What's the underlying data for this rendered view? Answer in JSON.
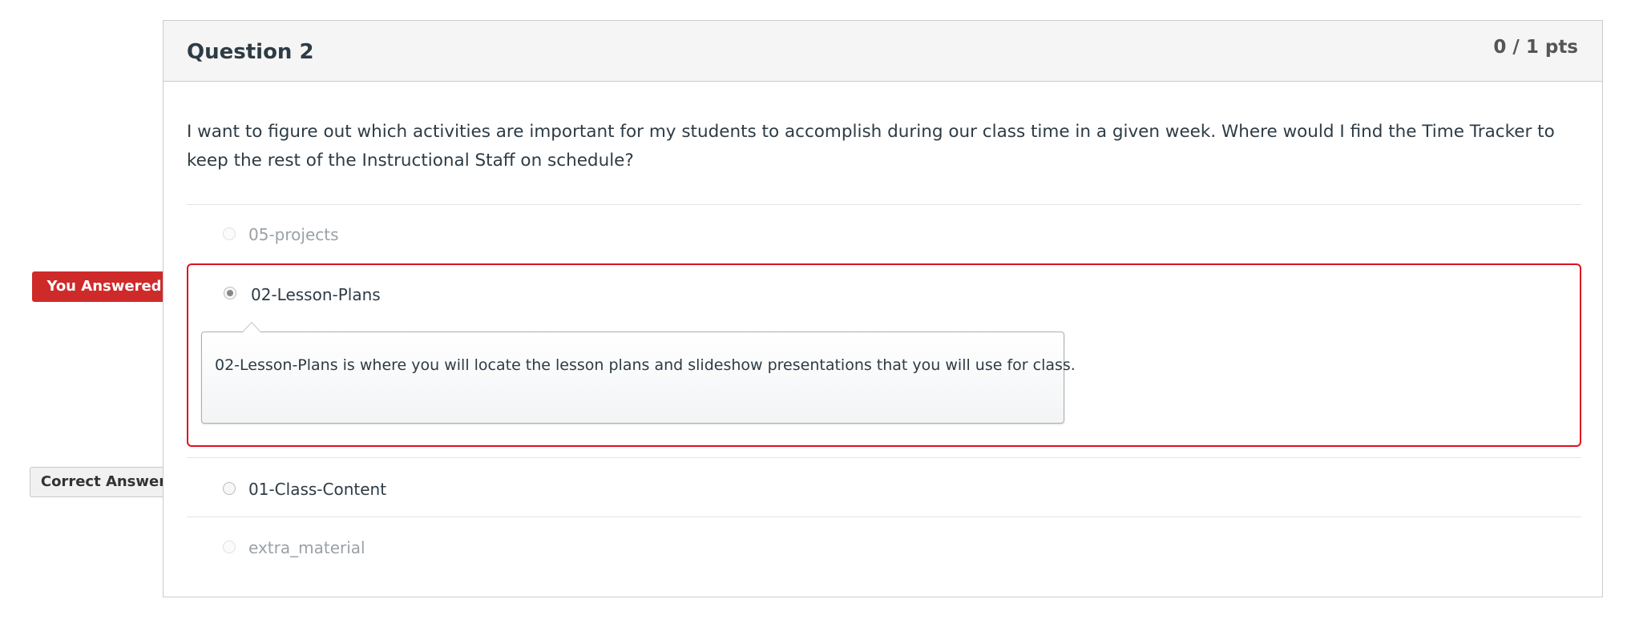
{
  "question": {
    "title": "Question 2",
    "points": "0 / 1 pts",
    "text": "I want to figure out which activities are important for my students to accomplish during our class time in a given week. Where would I find the Time Tracker to keep the rest of the Instructional Staff on schedule?"
  },
  "answers": [
    {
      "label": "05-projects",
      "state": "unselected"
    },
    {
      "label": "02-Lesson-Plans",
      "state": "selected"
    },
    {
      "label": "01-Class-Content",
      "state": "correct"
    },
    {
      "label": "extra_material",
      "state": "unselected"
    }
  ],
  "comment": {
    "text": "02-Lesson-Plans is where you will locate the lesson plans and slideshow presentations that you will use for class."
  },
  "flags": {
    "you_answered": "You Answered",
    "correct_answer": "Correct Answer"
  },
  "colors": {
    "selected_border": "#e0101e",
    "you_answered_flag": "#cf2a2a",
    "correct_flag": "#f1f1f1"
  }
}
